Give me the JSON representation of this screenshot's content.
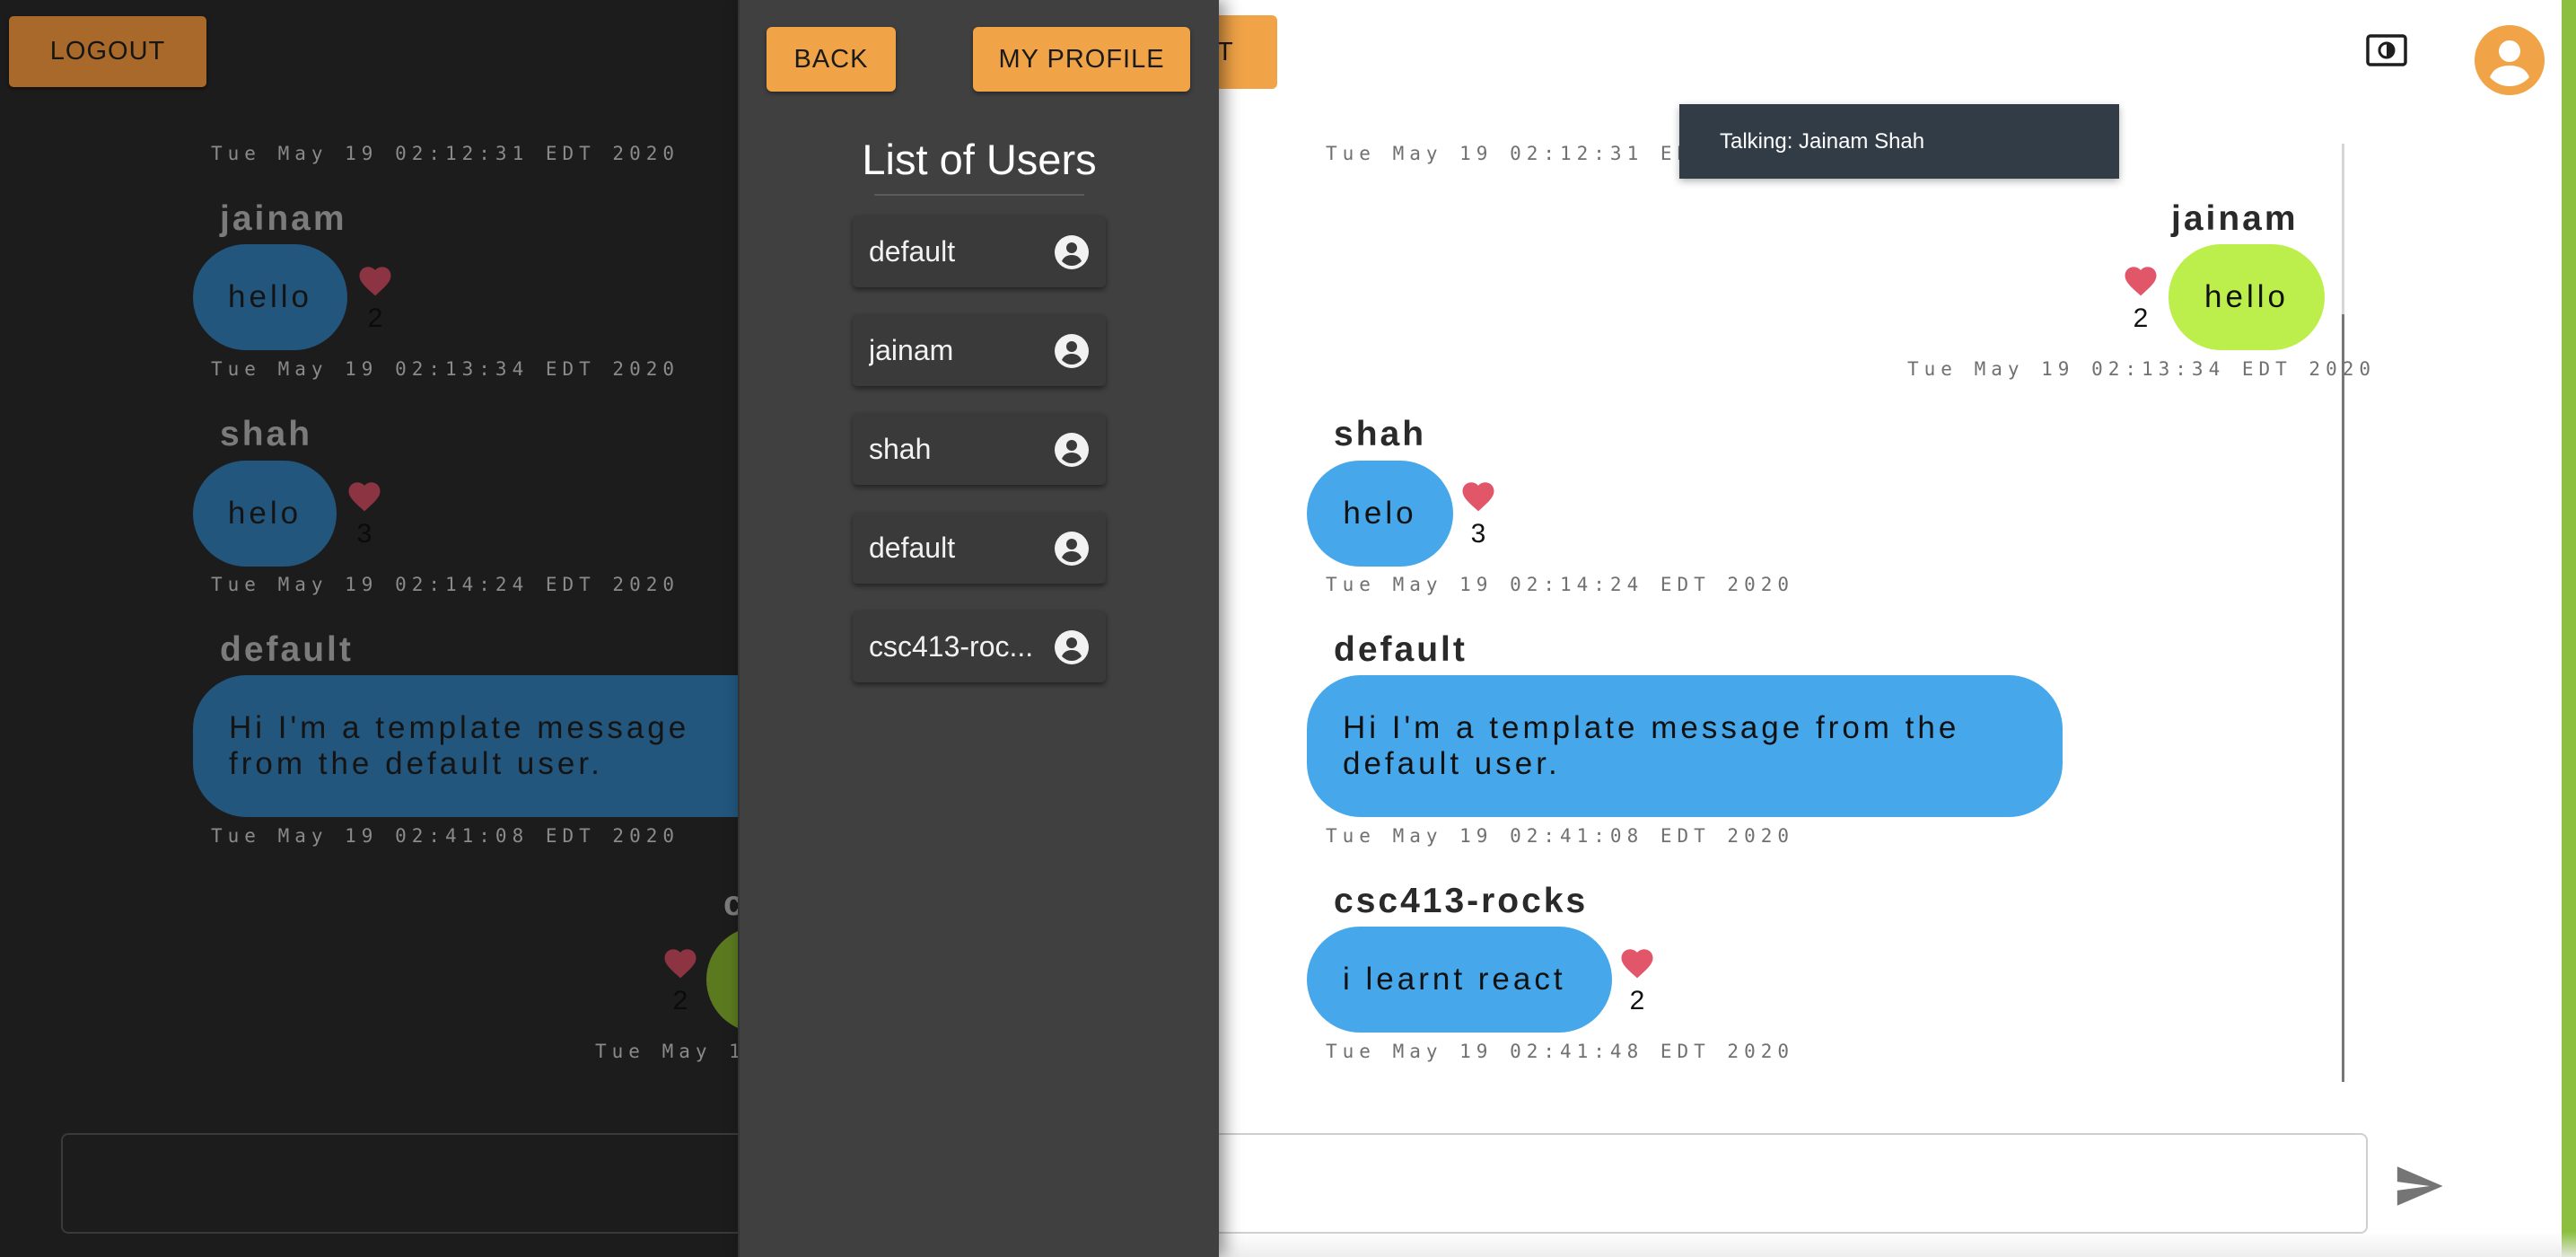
{
  "header": {
    "logout_label": "LOGOUT",
    "partial_button_label": "T",
    "tooltip": "Talking: Jainam Shah"
  },
  "drawer": {
    "back_label": "BACK",
    "profile_label": "MY PROFILE",
    "title": "List of Users",
    "users": [
      "default",
      "jainam",
      "shah",
      "default",
      "csc413-roc..."
    ]
  },
  "messages": [
    {
      "sender": "jainam",
      "text": "hello",
      "likes": "2",
      "timestamp": "Tue May 19 02:12:31 EDT 2020",
      "mine": true
    },
    {
      "sender": "shah",
      "text": "helo",
      "likes": "3",
      "timestamp": "Tue May 19 02:13:34 EDT 2020",
      "mine": false
    },
    {
      "sender": "default",
      "text": "Hi I'm a template message from the\ndefault user.",
      "likes": "",
      "timestamp": "Tue May 19 02:14:24 EDT 2020",
      "mine": false
    },
    {
      "sender": "csc413-rocks",
      "text": "i learnt react",
      "likes": "2",
      "timestamp": "Tue May 19 02:41:08 EDT 2020",
      "mine": false
    },
    {
      "sender": "",
      "text": "",
      "likes": "",
      "timestamp": "Tue May 19 02:41:48 EDT 2020",
      "mine": false
    }
  ],
  "dark_copy": {
    "default_text": "Hi I'm a template message\nfrom the default user.",
    "partial_timestamp": "Tue May 19",
    "partial_sender": "c"
  },
  "colors": {
    "accent_orange": "#f0a347",
    "bubble_blue": "#46a7ea",
    "bubble_green": "#bcef4c",
    "heart_red": "#e2566a",
    "drawer_bg": "#404040",
    "tooltip_bg": "#313c47"
  },
  "icons": {
    "theme": "brightness-toggle-icon",
    "avatar": "account-circle-icon",
    "send": "send-icon",
    "heart": "heart-icon",
    "user": "account-circle-icon"
  }
}
